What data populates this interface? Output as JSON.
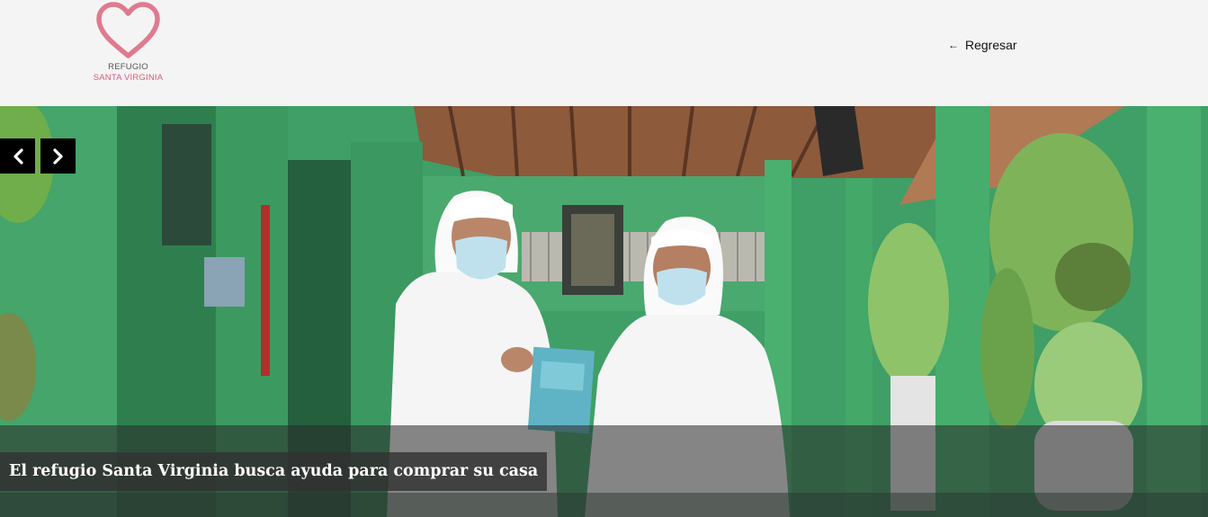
{
  "header": {
    "logo": {
      "line1": "REFUGIO",
      "line2": "SANTA VIRGINIA",
      "icon": "heart-icon",
      "color": "#d85c7a"
    },
    "back_link": {
      "label": "Regresar",
      "icon": "arrow-left-icon"
    }
  },
  "slider": {
    "prev_icon": "chevron-left-icon",
    "next_icon": "chevron-right-icon",
    "caption": "El refugio Santa Virginia busca ayuda para comprar su casa"
  },
  "colors": {
    "header_bg": "#f4f4f4",
    "brand": "#d85c7a",
    "wall_green": "#3b9a63"
  }
}
